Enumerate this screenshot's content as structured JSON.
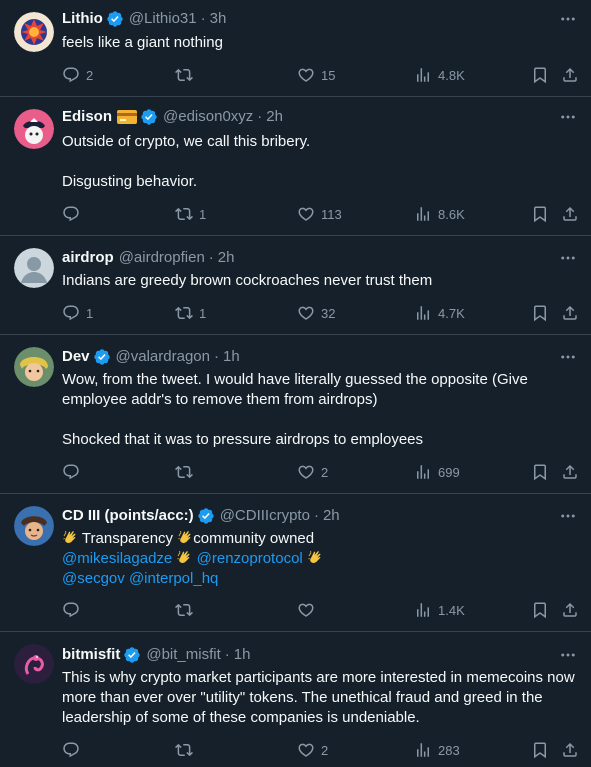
{
  "tweets": [
    {
      "name": "Lithio",
      "handle": "@Lithio31",
      "time": "3h",
      "lines": [
        "feels like a giant nothing"
      ],
      "replies": "2",
      "retweets": "",
      "likes": "15",
      "views": "4.8K"
    },
    {
      "name": "Edison",
      "handle": "@edison0xyz",
      "time": "2h",
      "line1": "Outside of crypto, we call this bribery.",
      "line2": "Disgusting behavior.",
      "replies": "",
      "retweets": "1",
      "likes": "113",
      "views": "8.6K"
    },
    {
      "name": "airdrop",
      "handle": "@airdropfien",
      "time": "2h",
      "line1": "Indians are greedy brown cockroaches never trust them",
      "replies": "1",
      "retweets": "1",
      "likes": "32",
      "views": "4.7K"
    },
    {
      "name": "Dev",
      "handle": "@valardragon",
      "time": "1h",
      "line1": "Wow, from the tweet. I would have literally guessed the opposite (Give",
      "line2": "employee addr's to remove them from airdrops)",
      "line3": "Shocked that it was to pressure airdrops to employees",
      "replies": "",
      "retweets": "",
      "likes": "2",
      "views": "699"
    },
    {
      "name": "CD III (points/acc:)",
      "handle": "@CDIIIcrypto",
      "time": "2h",
      "text1": "Transparency",
      "text2": "community owned",
      "mention1": "@mikesilagadze",
      "mention2": "@renzoprotocol",
      "mention3": "@secgov",
      "mention4": "@interpol_hq",
      "replies": "",
      "retweets": "",
      "likes": "",
      "views": "1.4K"
    },
    {
      "name": "bitmisfit",
      "handle": "@bit_misfit",
      "time": "1h",
      "line1": "This is why crypto market participants are more interested in memecoins now",
      "line2": "more than ever over \"utility\" tokens. The unethical fraud and greed in the",
      "line3": "leadership of some of these companies is undeniable.",
      "replies": "",
      "retweets": "",
      "likes": "2",
      "views": "283"
    }
  ],
  "separator": "·",
  "colors": {
    "background": "#15202b",
    "text": "#f7f9f9",
    "muted": "#8b98a5",
    "link": "#1d9bf0",
    "verified": "#1d9bf0",
    "divider": "#38444d"
  },
  "icons": [
    "reply-icon",
    "retweet-icon",
    "like-icon",
    "views-icon",
    "bookmark-icon",
    "share-icon",
    "more-icon",
    "verified-icon",
    "clap-emoji-icon",
    "card-icon"
  ]
}
